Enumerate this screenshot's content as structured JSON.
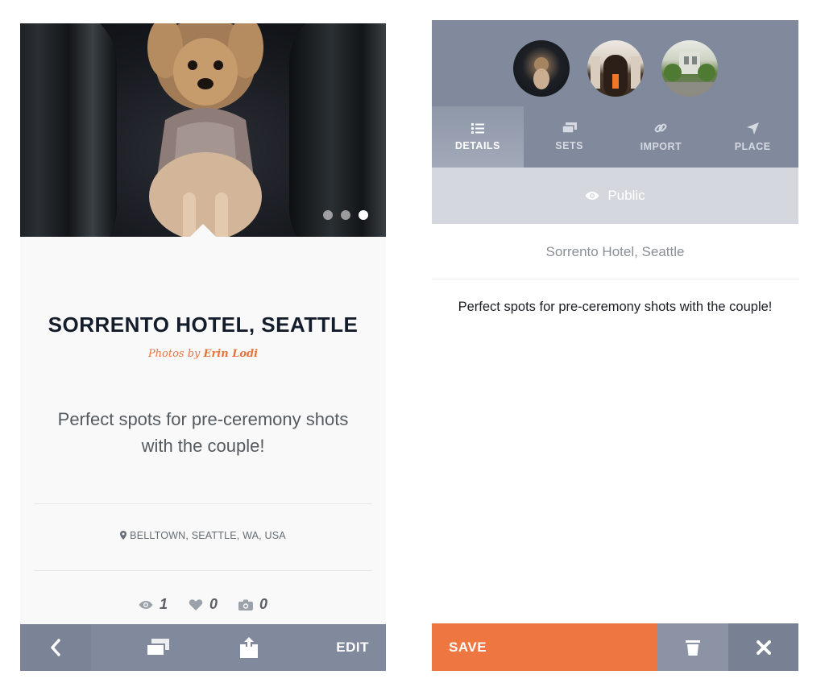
{
  "left_screen": {
    "carousel": {
      "total": 3,
      "active_index": 2
    },
    "title": "SORRENTO HOTEL, SEATTLE",
    "credit": {
      "prefix": "Photos by",
      "author": "Erin Lodi"
    },
    "description": "Perfect spots for pre-ceremony shots with the couple!",
    "location": "BELLTOWN, SEATTLE, WA, USA",
    "stats": {
      "views": "1",
      "likes": "0",
      "photos": "0"
    },
    "toolbar": {
      "edit_label": "EDIT"
    },
    "icons": {
      "back": "chevron-left-icon",
      "sets": "stack-icon",
      "share": "share-icon",
      "location": "map-pin-icon",
      "views": "eye-icon",
      "likes": "heart-icon",
      "photos": "camera-icon"
    }
  },
  "right_screen": {
    "tabs": [
      {
        "label": "DETAILS",
        "icon": "list-icon",
        "active": true
      },
      {
        "label": "SETS",
        "icon": "stack-icon",
        "active": false
      },
      {
        "label": "IMPORT",
        "icon": "link-icon",
        "active": false
      },
      {
        "label": "PLACE",
        "icon": "navigation-arrow-icon",
        "active": false
      }
    ],
    "visibility": "Public",
    "place_name": "Sorrento Hotel, Seattle",
    "description": "Perfect spots for pre-ceremony shots with the couple!",
    "actions": {
      "save_label": "SAVE",
      "delete_icon": "trash-icon",
      "close_icon": "close-icon"
    }
  },
  "colors": {
    "accent": "#ee7741",
    "toolbar": "#818a9c",
    "title": "#141d2b",
    "credit": "#e8743b"
  }
}
